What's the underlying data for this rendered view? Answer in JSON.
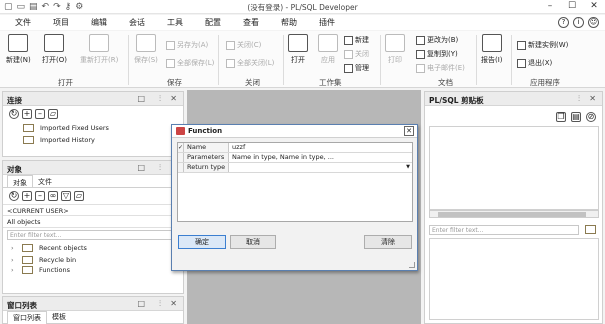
{
  "window": {
    "title": "(没有登录) - PL/SQL Developer",
    "qa_icons": [
      "new-icon",
      "open-icon",
      "save-icon",
      "undo-icon",
      "redo-icon",
      "key-icon",
      "tools-icon"
    ]
  },
  "menu": {
    "items": [
      "文件",
      "项目",
      "编辑",
      "会话",
      "工具",
      "配置",
      "查看",
      "帮助",
      "插件"
    ],
    "help_icons": [
      "?",
      "i",
      "☺"
    ]
  },
  "ribbon": {
    "file_group": {
      "label": "打开",
      "new": "新建(N)",
      "open": "打开(O)",
      "reopen": "重新打开(R)"
    },
    "save_group": {
      "label": "保存",
      "save": "保存(S)",
      "save_as": "另存为(A)",
      "save_all": "全部保存(L)"
    },
    "close_group": {
      "label": "关闭",
      "close": "关闭(C)",
      "close_all": "全部关闭(L)"
    },
    "workspace_group": {
      "label": "工作集",
      "open": "打开",
      "apply": "应用",
      "new": "新建",
      "close": "关闭",
      "manage": "管理"
    },
    "print_group": {
      "print": "打印"
    },
    "doc_group": {
      "label": "文档",
      "changed": "更改为(B)",
      "copy": "复制到(Y)",
      "email": "电子邮件(E)"
    },
    "report_group": {
      "report": "报告(I)"
    },
    "app_group": {
      "label": "应用程序",
      "new_instance": "新建实例(W)",
      "exit": "退出(X)"
    }
  },
  "connections_panel": {
    "title": "连接",
    "items": [
      "Imported Fixed Users",
      "Imported History"
    ]
  },
  "objects_panel": {
    "title": "对象",
    "tabs": [
      "对象",
      "文件"
    ],
    "user_select": "<CURRENT USER>",
    "scope_select": "All objects",
    "filter_placeholder": "Enter filter text...",
    "tree": [
      "Recent objects",
      "Recycle bin",
      "Functions"
    ]
  },
  "windows_panel": {
    "title": "窗口列表",
    "tabs": [
      "窗口列表",
      "模板"
    ]
  },
  "clipboard_panel": {
    "title": "PL/SQL 剪贴板",
    "filter_placeholder": "Enter filter text..."
  },
  "dialog": {
    "title": "Function",
    "rows": [
      {
        "mark": "✓",
        "label": "Name",
        "value": "uzzf"
      },
      {
        "mark": "",
        "label": "Parameters",
        "value": "Name in type, Name in type, ..."
      },
      {
        "mark": "",
        "label": "Return type",
        "value": ""
      }
    ],
    "ok": "确定",
    "cancel": "取消",
    "clear": "清除"
  },
  "colors": {
    "dialog_border": "#5a7fb0",
    "primary_button": "#3c7fd0",
    "workspace_bg": "#b7b7b7"
  }
}
